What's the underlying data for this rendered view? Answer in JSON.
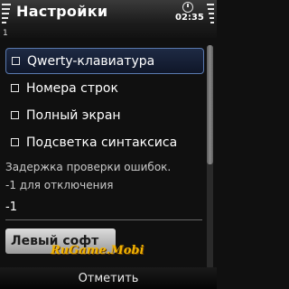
{
  "statusbar": {
    "title": "Настройки",
    "time": "02:35",
    "antenna_mark": "1"
  },
  "list": {
    "items": [
      {
        "label": "Qwerty-клавиатура",
        "selected": true
      },
      {
        "label": "Номера строк",
        "selected": false
      },
      {
        "label": "Полный экран",
        "selected": false
      },
      {
        "label": "Подсветка синтаксиса",
        "selected": false
      }
    ]
  },
  "delay": {
    "label_line1": "Задержка проверки ошибок.",
    "label_line2": "-1 для отключения",
    "value": "-1"
  },
  "softkeys": {
    "left_button": "Левый софт",
    "center": "Отметить"
  },
  "watermark": "RuGame.Mobi",
  "colors": {
    "selection_border": "#5a7ab0",
    "watermark": "#f2b400"
  }
}
